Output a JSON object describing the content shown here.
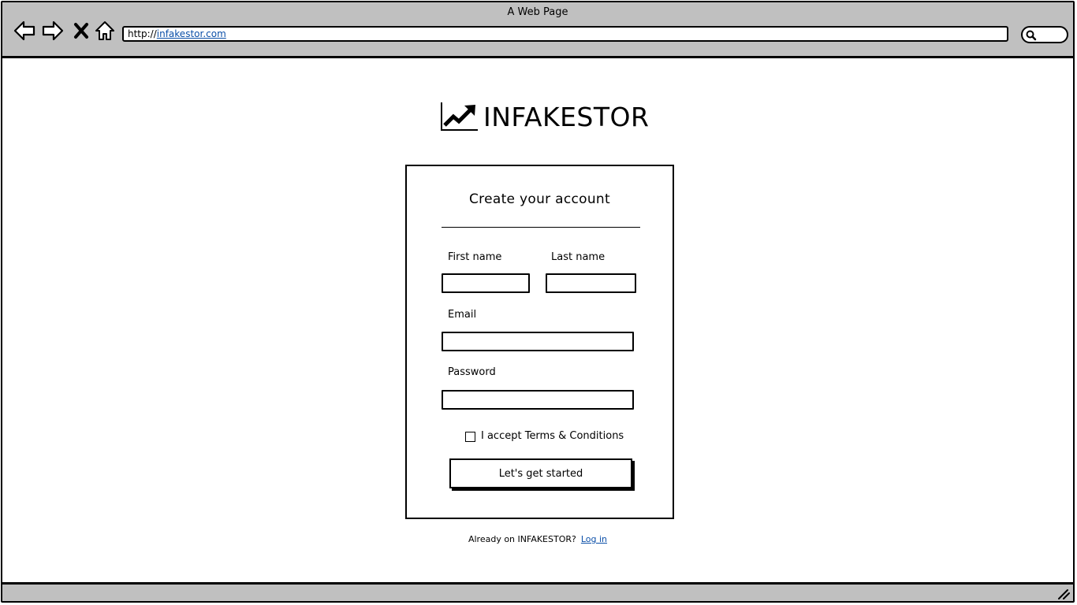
{
  "window": {
    "title": "A Web Page"
  },
  "browser": {
    "url_prefix": "http://",
    "url_domain": "infakestor.com",
    "icons": [
      "back-arrow-icon",
      "forward-arrow-icon",
      "close-x-icon",
      "home-icon",
      "search-icon",
      "resize-grip-icon"
    ]
  },
  "logo": {
    "text": "INFAKESTOR",
    "icon": "trending-up-chart-icon"
  },
  "form": {
    "title": "Create your account",
    "first_name_label": "First name",
    "last_name_label": "Last name",
    "email_label": "Email",
    "password_label": "Password",
    "first_name_value": "",
    "last_name_value": "",
    "email_value": "",
    "password_value": "",
    "terms_label": "I accept Terms & Conditions",
    "terms_checked": false,
    "submit_label": "Let's get started"
  },
  "footer": {
    "prompt": "Already on INFAKESTOR?",
    "login_link": "Log in"
  }
}
